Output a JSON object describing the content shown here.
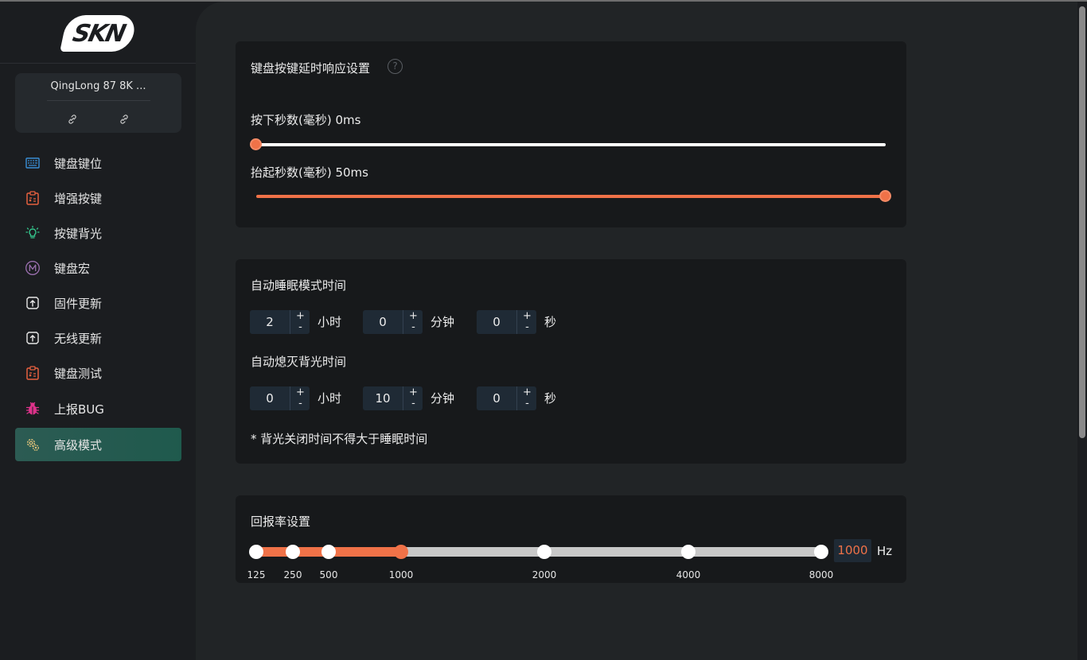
{
  "brand": {
    "logo_text": "SKN"
  },
  "device": {
    "name": "QingLong 87 8K ..."
  },
  "nav": {
    "items": [
      {
        "label": "键盘键位",
        "icon": "keyboard-grid-icon"
      },
      {
        "label": "增强按键",
        "icon": "clipboard-x-icon"
      },
      {
        "label": "按键背光",
        "icon": "lightbulb-icon"
      },
      {
        "label": "键盘宏",
        "icon": "macro-m-icon"
      },
      {
        "label": "固件更新",
        "icon": "firmware-update-icon"
      },
      {
        "label": "无线更新",
        "icon": "wireless-update-icon"
      },
      {
        "label": "键盘测试",
        "icon": "clipboard-x-icon"
      },
      {
        "label": "上报BUG",
        "icon": "bug-icon"
      },
      {
        "label": "高级模式",
        "icon": "gears-icon"
      }
    ],
    "active_index": 8
  },
  "delay": {
    "title": "键盘按键延时响应设置",
    "help": "?",
    "press_label": "按下秒数(毫秒) 0ms",
    "press_value_ms": 0,
    "release_label": "抬起秒数(毫秒) 50ms",
    "release_value_ms": 50
  },
  "sleep": {
    "title": "自动睡眠模式时间",
    "hours": "2",
    "minutes": "0",
    "seconds": "0",
    "unit_hours": "小时",
    "unit_minutes": "分钟",
    "unit_seconds": "秒"
  },
  "backlight": {
    "title": "自动熄灭背光时间",
    "hours": "0",
    "minutes": "10",
    "seconds": "0",
    "unit_hours": "小时",
    "unit_minutes": "分钟",
    "unit_seconds": "秒",
    "note": "* 背光关闭时间不得大于睡眠时间"
  },
  "spinner": {
    "plus": "+",
    "minus": "-"
  },
  "polling": {
    "title": "回报率设置",
    "options": [
      "125",
      "250",
      "500",
      "1000",
      "2000",
      "4000",
      "8000"
    ],
    "selected_index": 3,
    "value": "1000",
    "unit": "Hz"
  },
  "colors": {
    "accent": "#f07248",
    "active_nav": "#1f5a4d",
    "card_bg": "#17191b"
  }
}
